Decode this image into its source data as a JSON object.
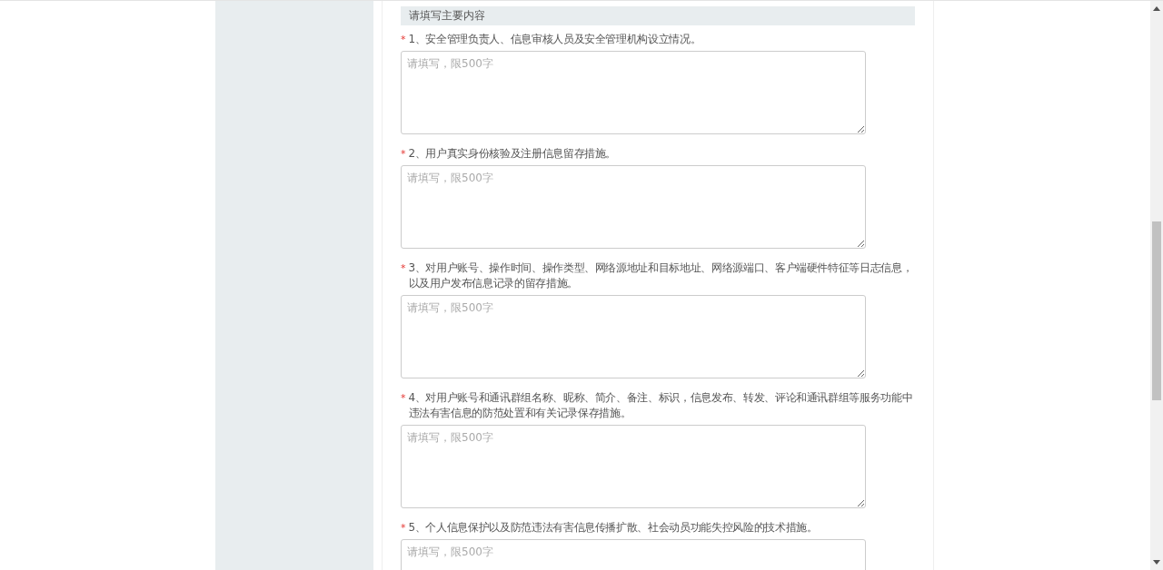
{
  "section": {
    "title": "请填写主要内容"
  },
  "questions": [
    {
      "required": true,
      "mark": "*",
      "label": "1、安全管理负责人、信息审核人员及安全管理机构设立情况。",
      "placeholder": "请填写，限500字"
    },
    {
      "required": true,
      "mark": "*",
      "label": "2、用户真实身份核验及注册信息留存措施。",
      "placeholder": "请填写，限500字"
    },
    {
      "required": true,
      "mark": "*",
      "label": "3、对用户账号、操作时间、操作类型、网络源地址和目标地址、网络源端口、客户端硬件特征等日志信息，以及用户发布信息记录的留存措施。",
      "placeholder": "请填写，限500字"
    },
    {
      "required": true,
      "mark": "*",
      "label": "4、对用户账号和通讯群组名称、昵称、简介、备注、标识，信息发布、转发、评论和通讯群组等服务功能中违法有害信息的防范处置和有关记录保存措施。",
      "placeholder": "请填写，限500字"
    },
    {
      "required": true,
      "mark": "*",
      "label": "5、个人信息保护以及防范违法有害信息传播扩散、社会动员功能失控风险的技术措施。",
      "placeholder": "请填写，限500字"
    }
  ]
}
